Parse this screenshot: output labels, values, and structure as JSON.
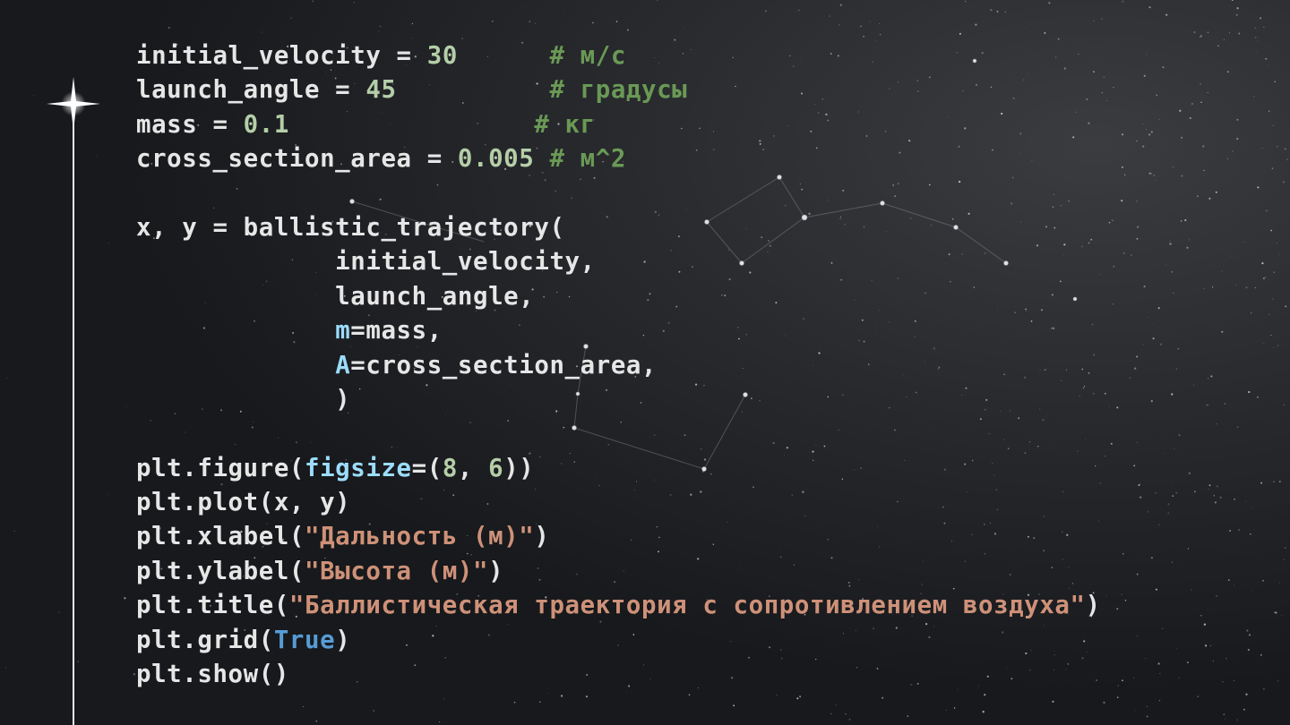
{
  "colors": {
    "background": "#1c1e21",
    "default": "#e6e6e6",
    "number": "#b5cea8",
    "comment": "#6a9955",
    "kwarg": "#9cdcfe",
    "string": "#ce9178",
    "keyword": "#569cd6"
  },
  "icons": [
    "sparkle-star-icon"
  ],
  "code_lines": [
    [
      [
        "default",
        "initial_velocity = "
      ],
      [
        "number",
        "30"
      ],
      [
        "default",
        "      "
      ],
      [
        "comment",
        "# м/с"
      ]
    ],
    [
      [
        "default",
        "launch_angle = "
      ],
      [
        "number",
        "45"
      ],
      [
        "default",
        "          "
      ],
      [
        "comment",
        "# градусы"
      ]
    ],
    [
      [
        "default",
        "mass = "
      ],
      [
        "number",
        "0.1"
      ],
      [
        "default",
        "                "
      ],
      [
        "comment",
        "# кг"
      ]
    ],
    [
      [
        "default",
        "cross_section_area = "
      ],
      [
        "number",
        "0.005"
      ],
      [
        "default",
        " "
      ],
      [
        "comment",
        "# м^2"
      ]
    ],
    [],
    [
      [
        "default",
        "x, y = ballistic_trajectory("
      ]
    ],
    [
      [
        "default",
        "             initial_velocity,"
      ]
    ],
    [
      [
        "default",
        "             launch_angle,"
      ]
    ],
    [
      [
        "default",
        "             "
      ],
      [
        "kwarg",
        "m"
      ],
      [
        "default",
        "=mass,"
      ]
    ],
    [
      [
        "default",
        "             "
      ],
      [
        "kwarg",
        "A"
      ],
      [
        "default",
        "=cross_section_area,"
      ]
    ],
    [
      [
        "default",
        "             )"
      ]
    ],
    [],
    [
      [
        "default",
        "plt.figure("
      ],
      [
        "kwarg",
        "figsize"
      ],
      [
        "default",
        "=("
      ],
      [
        "number",
        "8"
      ],
      [
        "default",
        ", "
      ],
      [
        "number",
        "6"
      ],
      [
        "default",
        "))"
      ]
    ],
    [
      [
        "default",
        "plt.plot(x, y)"
      ]
    ],
    [
      [
        "default",
        "plt.xlabel("
      ],
      [
        "string",
        "\"Дальность (м)\""
      ],
      [
        "default",
        ")"
      ]
    ],
    [
      [
        "default",
        "plt.ylabel("
      ],
      [
        "string",
        "\"Высота (м)\""
      ],
      [
        "default",
        ")"
      ]
    ],
    [
      [
        "default",
        "plt.title("
      ],
      [
        "string",
        "\"Баллистическая траектория с сопротивлением воздуха\""
      ],
      [
        "default",
        ")"
      ]
    ],
    [
      [
        "default",
        "plt.grid("
      ],
      [
        "keyword",
        "True"
      ],
      [
        "default",
        ")"
      ]
    ],
    [
      [
        "default",
        "plt.show()"
      ]
    ]
  ]
}
